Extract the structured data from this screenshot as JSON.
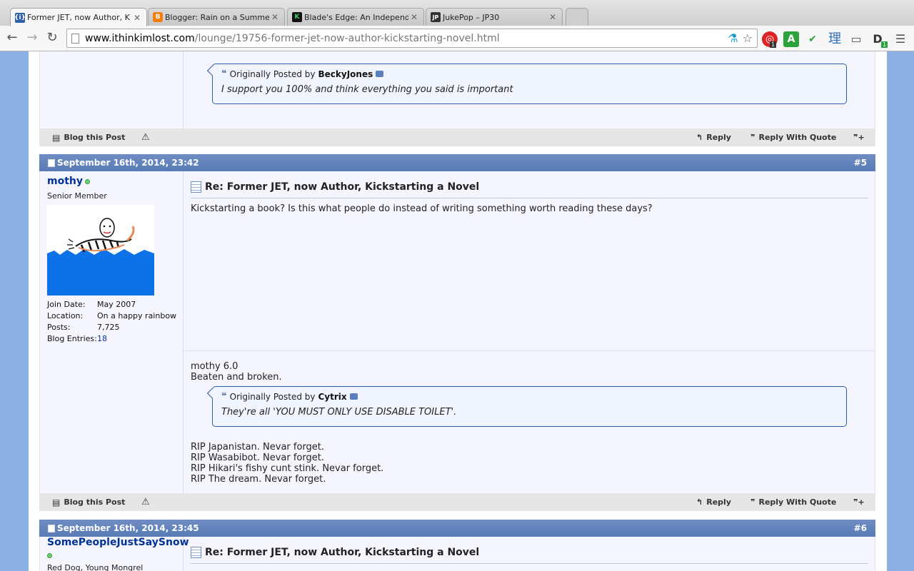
{
  "browser": {
    "tabs": [
      {
        "title": "Former JET, now Author, K",
        "favicon": "{i}",
        "active": true
      },
      {
        "title": "Blogger: Rain on a Summe",
        "favicon": "B",
        "active": false
      },
      {
        "title": "Blade's Edge: An Independ",
        "favicon": "K",
        "active": false
      },
      {
        "title": "JukePop – JP30",
        "favicon": "JP",
        "active": false
      }
    ],
    "url_host": "www.ithinkimlost.com",
    "url_path": "/lounge/19756-former-jet-now-author-kickstarting-novel.html",
    "ext_badge_1": "1",
    "ext_badge_2": "1",
    "ext_kanji": "理"
  },
  "top_post": {
    "quote": {
      "prefix": "Originally Posted by",
      "author": "BeckyJones",
      "text": "I support you 100% and think everything you said is important"
    },
    "footer": {
      "blog_this_post": "Blog this Post",
      "reply": "Reply",
      "reply_with_quote": "Reply With Quote"
    }
  },
  "post5": {
    "date": "September 16th, 2014, 23:42",
    "number": "#5",
    "username": "mothy",
    "rank": "Senior Member",
    "stats": {
      "join_label": "Join Date:",
      "join_value": "May 2007",
      "location_label": "Location:",
      "location_value": "On a happy rainbow",
      "posts_label": "Posts:",
      "posts_value": "7,725",
      "blog_label": "Blog Entries:",
      "blog_value": "18"
    },
    "title": "Re: Former JET, now Author, Kickstarting a Novel",
    "message": "Kickstarting a book? Is this what people do instead of writing something worth reading these days?",
    "signature_top": "mothy 6.0\nBeaten and broken.",
    "sig_quote": {
      "prefix": "Originally Posted by",
      "author": "Cytrix",
      "text": "They're all 'YOU MUST ONLY USE DISABLE TOILET'."
    },
    "signature_bottom": "RIP Japanistan. Nevar forget.\nRIP Wasabibot. Nevar forget.\nRIP Hikari's fishy cunt stink. Nevar forget.\nRIP The dream. Nevar forget.",
    "footer": {
      "blog_this_post": "Blog this Post",
      "reply": "Reply",
      "reply_with_quote": "Reply With Quote"
    }
  },
  "post6": {
    "date": "September 16th, 2014, 23:45",
    "number": "#6",
    "username": "SomePeopleJustSaySnow",
    "rank": "Red Dog, Young Mongrel",
    "title": "Re: Former JET, now Author, Kickstarting a Novel"
  },
  "colors": {
    "header_blue": "#5f80ba",
    "link_blue": "#003399",
    "quote_border": "#2f5ea8",
    "page_bg": "#8cb0e4"
  }
}
